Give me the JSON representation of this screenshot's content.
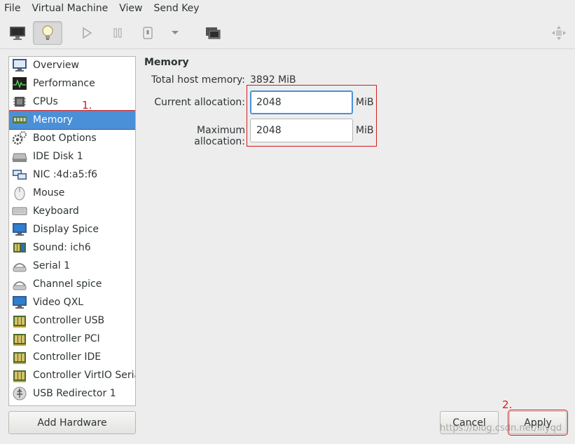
{
  "menubar": {
    "items": [
      "File",
      "Virtual Machine",
      "View",
      "Send Key"
    ]
  },
  "toolbar": {
    "icons": [
      "monitor-icon",
      "lightbulb-icon",
      "play-icon",
      "pause-icon",
      "power-icon",
      "dropdown-icon",
      "screenshot-icon",
      "fullscreen-icon"
    ]
  },
  "sidebar": {
    "items": [
      {
        "label": "Overview",
        "icon": "overview-icon"
      },
      {
        "label": "Performance",
        "icon": "performance-icon"
      },
      {
        "label": "CPUs",
        "icon": "cpu-icon"
      },
      {
        "label": "Memory",
        "icon": "memory-icon"
      },
      {
        "label": "Boot Options",
        "icon": "boot-options-icon"
      },
      {
        "label": "IDE Disk 1",
        "icon": "disk-icon"
      },
      {
        "label": "NIC :4d:a5:f6",
        "icon": "nic-icon"
      },
      {
        "label": "Mouse",
        "icon": "mouse-icon"
      },
      {
        "label": "Keyboard",
        "icon": "keyboard-icon"
      },
      {
        "label": "Display Spice",
        "icon": "display-icon"
      },
      {
        "label": "Sound: ich6",
        "icon": "sound-icon"
      },
      {
        "label": "Serial 1",
        "icon": "serial-icon"
      },
      {
        "label": "Channel spice",
        "icon": "channel-icon"
      },
      {
        "label": "Video QXL",
        "icon": "video-icon"
      },
      {
        "label": "Controller USB",
        "icon": "controller-icon"
      },
      {
        "label": "Controller PCI",
        "icon": "controller-icon"
      },
      {
        "label": "Controller IDE",
        "icon": "controller-icon"
      },
      {
        "label": "Controller VirtIO Serial",
        "icon": "controller-icon"
      },
      {
        "label": "USB Redirector 1",
        "icon": "usb-redirector-icon"
      }
    ],
    "selected_index": 3,
    "add_hardware_label": "Add Hardware"
  },
  "memory": {
    "title": "Memory",
    "total_label": "Total host memory:",
    "total_value": "3892 MiB",
    "current_label": "Current allocation:",
    "current_value": "2048",
    "maximum_label": "Maximum allocation:",
    "maximum_value": "2048",
    "unit": "MiB",
    "minus": "−",
    "plus": "+"
  },
  "annotations": {
    "step1": "1.",
    "step2": "2."
  },
  "footer": {
    "cancel_label": "Cancel",
    "apply_label": "Apply"
  },
  "watermark": "https://blog.csdn.net/lllyqd",
  "colors": {
    "selection": "#4a90d9",
    "annotation": "#d01d1d"
  }
}
